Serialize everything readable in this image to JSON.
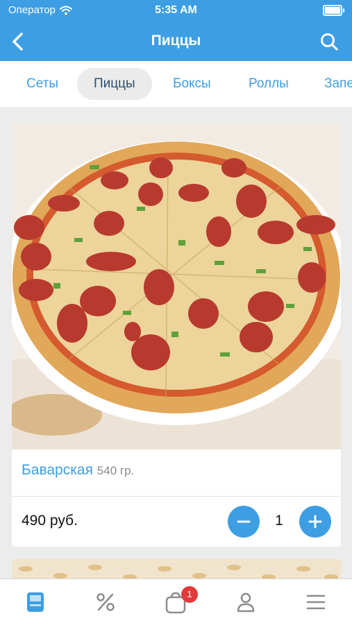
{
  "status_bar": {
    "carrier": "Оператор",
    "time": "5:35 AM"
  },
  "nav": {
    "title": "Пиццы",
    "back_icon": "chevron-left-icon",
    "search_icon": "search-icon"
  },
  "tabs": [
    {
      "label": "Сеты"
    },
    {
      "label": "Пиццы",
      "active": true
    },
    {
      "label": "Боксы"
    },
    {
      "label": "Роллы"
    },
    {
      "label": "Запе"
    }
  ],
  "product": {
    "name": "Баварская",
    "weight": "540 гр.",
    "price": "490 руб.",
    "quantity": "1",
    "image": "pizza-photo"
  },
  "bottom_nav": {
    "items": [
      "catalog-icon",
      "percent-icon",
      "cart-icon",
      "profile-icon",
      "menu-icon"
    ],
    "cart_badge": "1"
  },
  "colors": {
    "accent": "#3d9ee3",
    "badge": "#e23a3a",
    "active_tab_bg": "#ebebeb"
  }
}
